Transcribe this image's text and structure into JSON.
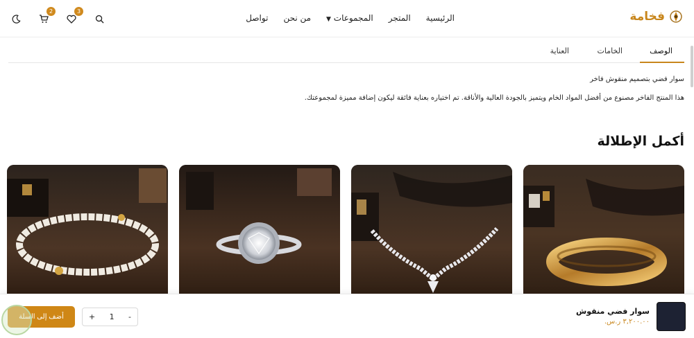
{
  "header": {
    "logo_text": "فخامة",
    "nav": [
      {
        "label": "الرئيسية"
      },
      {
        "label": "المتجر"
      },
      {
        "label": "المجموعات",
        "caret": "▼"
      },
      {
        "label": "من نحن"
      },
      {
        "label": "تواصل"
      }
    ],
    "wishlist_count": "3",
    "cart_count": "2",
    "icons": [
      "search-icon",
      "heart-icon",
      "cart-icon",
      "moon-icon"
    ]
  },
  "tabs": [
    {
      "label": "الوصف",
      "active": true
    },
    {
      "label": "الخامات",
      "active": false
    },
    {
      "label": "العناية",
      "active": false
    }
  ],
  "description": {
    "title": "سوار فضي بتصميم منقوش فاخر",
    "body": "هذا المنتج الفاخر مصنوع من أفضل المواد الخام ويتميز بالجودة العالية والأناقة. تم اختياره بعناية فائقة ليكون إضافة مميزة لمجموعتك."
  },
  "related": {
    "title": "أكمل الإطلالة",
    "products": [
      {
        "image": "gold-bangle"
      },
      {
        "image": "diamond-tennis-necklace"
      },
      {
        "image": "diamond-halo-ring"
      },
      {
        "image": "pearl-necklace"
      }
    ]
  },
  "bottombar": {
    "product_name": "سوار فضي منقوش",
    "price": "٣,٢٠٠.٠٠ ر.س.",
    "quantity": "1",
    "minus_label": "-",
    "plus_label": "+",
    "add_to_cart_label": "أضف إلى السلة"
  },
  "colors": {
    "accent": "#c8861c",
    "button": "#cf8716",
    "thumb": "#1d2233"
  }
}
